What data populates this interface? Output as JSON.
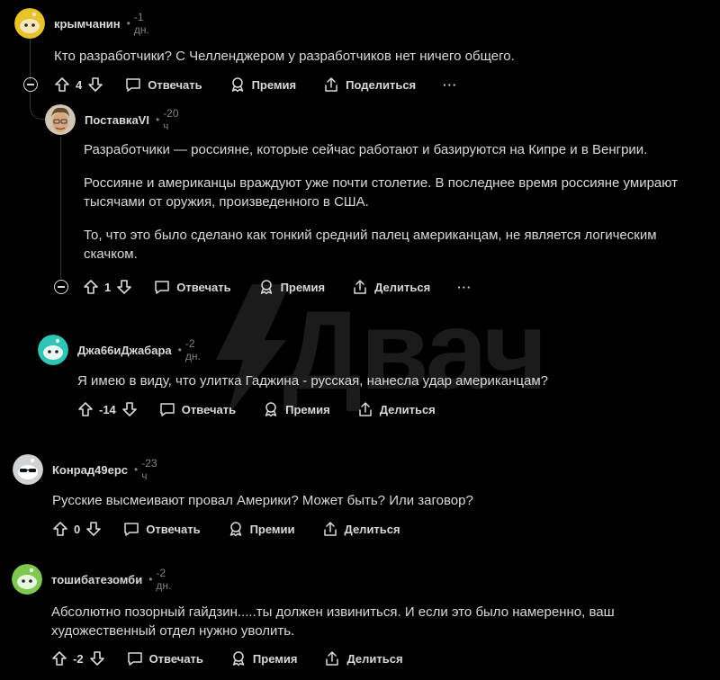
{
  "watermark": {
    "text": "Двач"
  },
  "comments": [
    {
      "author": "крымчанин",
      "dot": "•",
      "time": "-1 дн.",
      "body": [
        "Кто разработчики? С Челленджером у разработчиков нет ничего общего."
      ],
      "score": "4",
      "reply": "Отвечать",
      "award": "Премия",
      "share": "Поделиться",
      "more": "···",
      "avatar_color": "#e8c22b"
    },
    {
      "author": "ПоставкаVI",
      "dot": "•",
      "time": "-20 ч",
      "body": [
        "Разработчики — россияне, которые сейчас работают и базируются на Кипре и в Венгрии.",
        "Россияне и американцы враждуют уже почти столетие. В последнее время россияне умирают тысячами от оружия, произведенного в США.",
        "То, что это было сделано как тонкий средний палец американцам, не является логическим скачком."
      ],
      "score": "1",
      "reply": "Отвечать",
      "award": "Премия",
      "share": "Делиться",
      "more": "···",
      "avatar_color": "#7a5a3a"
    },
    {
      "author": "Джа66иДжабара",
      "dot": "•",
      "time": "-2 дн.",
      "body": [
        "Я имею в виду, что улитка Гаджина - русская, нанесла удар американцам?"
      ],
      "score": "-14",
      "reply": "Отвечать",
      "award": "Премия",
      "share": "Делиться",
      "avatar_color": "#2ec4b6"
    },
    {
      "author": "Конрад49ерс",
      "dot": "•",
      "time": "-23 ч",
      "body": [
        "Русские высмеивают провал Америки? Может быть? Или заговор?"
      ],
      "score": "0",
      "reply": "Отвечать",
      "award": "Премии",
      "share": "Делиться",
      "avatar_color": "#cfd3d6"
    },
    {
      "author": "тошибатезомби",
      "dot": "•",
      "time": "-2 дн.",
      "body": [
        "Абсолютно позорный гайдзин.....ты должен извиниться. И если это было намеренно, ваш художественный отдел нужно уволить."
      ],
      "score": "-2",
      "reply": "Отвечать",
      "award": "Премия",
      "share": "Делиться",
      "avatar_color": "#7ec850"
    }
  ]
}
